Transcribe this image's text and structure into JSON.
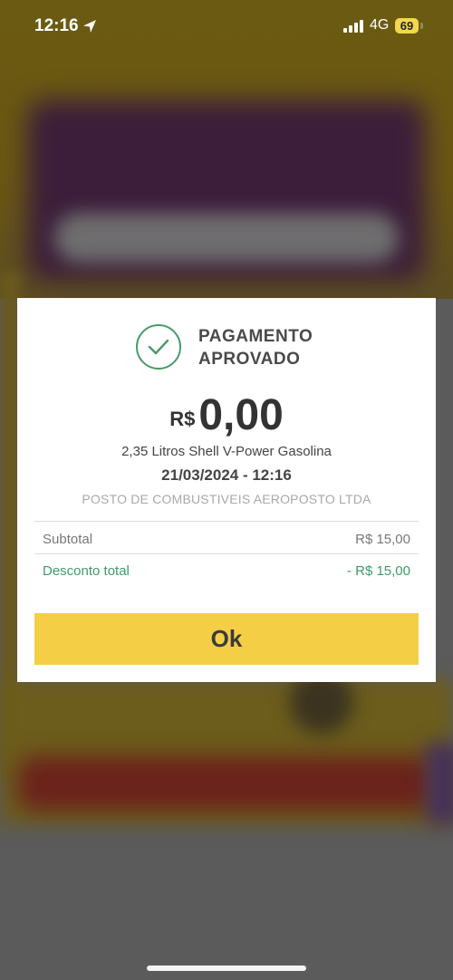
{
  "status_bar": {
    "time": "12:16",
    "network": "4G",
    "battery": "69",
    "icons": [
      "location-arrow-icon",
      "signal-icon",
      "battery-icon"
    ]
  },
  "modal": {
    "title_line1": "PAGAMENTO",
    "title_line2": "APROVADO",
    "status_icon": "check-circle-icon",
    "currency": "R$",
    "amount": "0,00",
    "product": "2,35 Litros Shell V-Power Gasolina",
    "datetime": "21/03/2024 - 12:16",
    "station": "POSTO DE COMBUSTIVEIS AEROPOSTO LTDA",
    "subtotal_label": "Subtotal",
    "subtotal_value": "R$ 15,00",
    "discount_label": "Desconto total",
    "discount_value": "- R$ 15,00",
    "ok_label": "Ok"
  },
  "colors": {
    "accent_yellow": "#f4cf45",
    "success_green": "#4a9a6c",
    "discount_green": "#3f9a6b"
  }
}
